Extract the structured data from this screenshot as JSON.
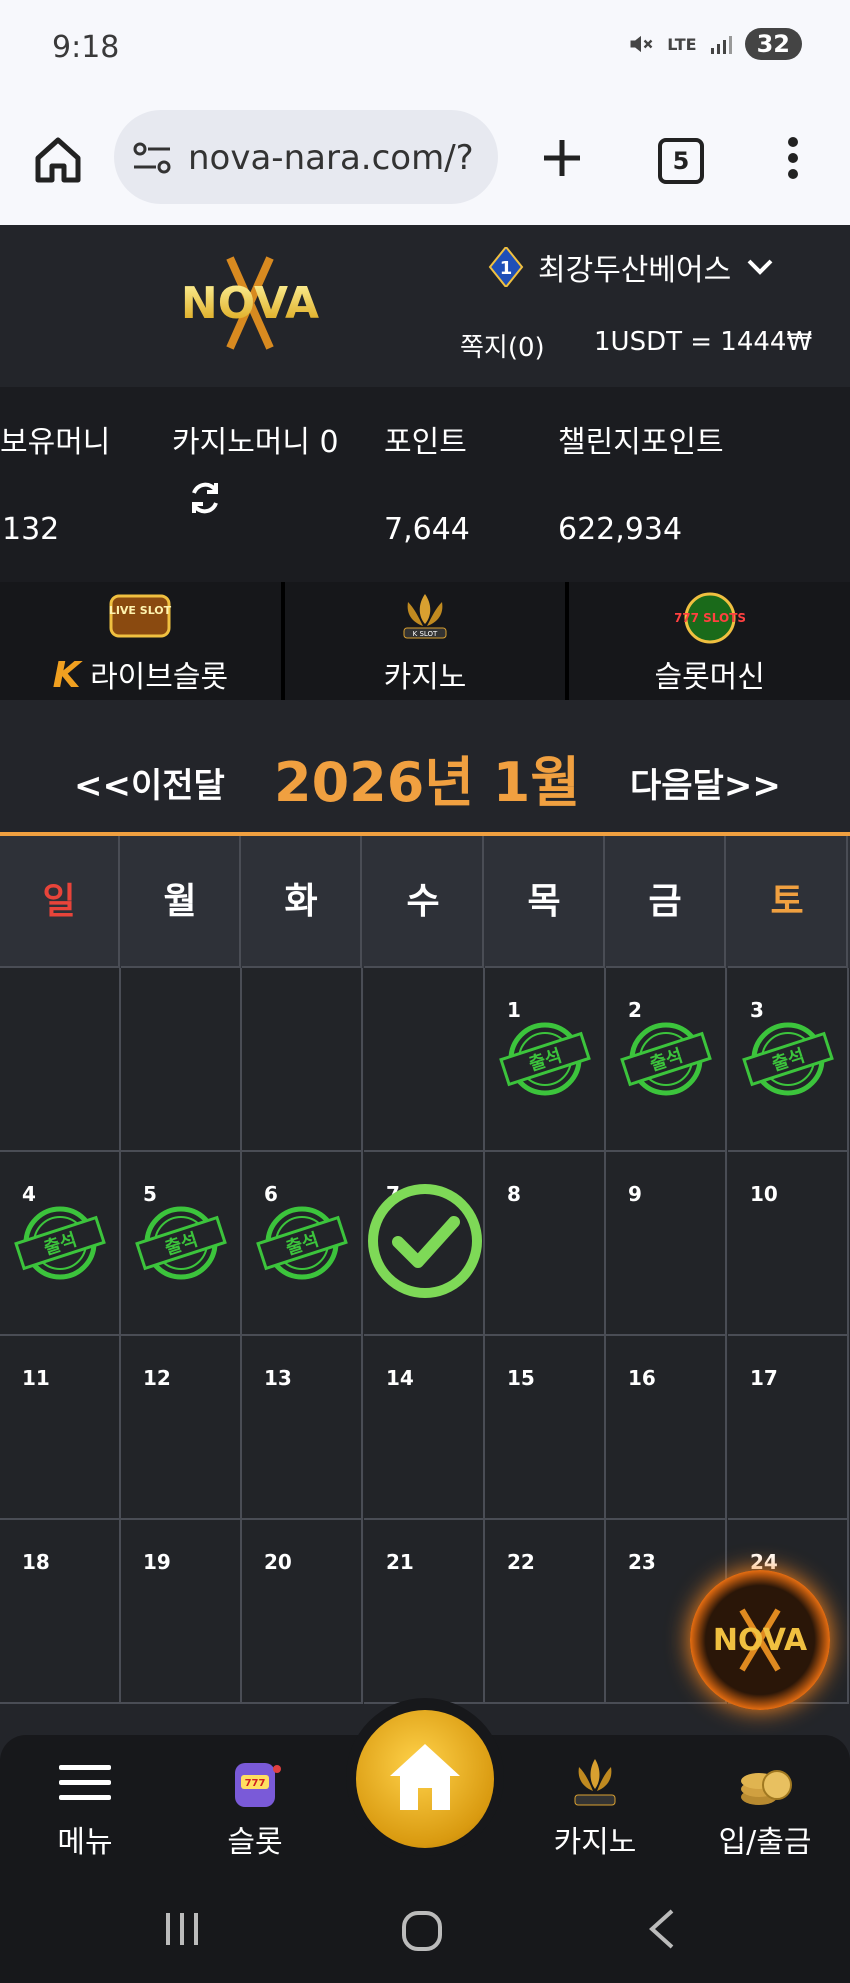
{
  "status_bar": {
    "time": "9:18",
    "network": "LTE",
    "battery": "32"
  },
  "browser": {
    "url": "nova-nara.com/?",
    "tab_count": "5"
  },
  "header": {
    "logo_text": "NOVA",
    "username": "최강두산베어스",
    "level": "1",
    "messages": "쪽지(0)",
    "exchange_rate": "1USDT = 1444₩"
  },
  "balances": {
    "holding_label": "보유머니",
    "holding_value": "132",
    "casino_label": "카지노머니 0",
    "points_label": "포인트",
    "points_value": "7,644",
    "challenge_label": "챌린지포인트",
    "challenge_value": "622,934"
  },
  "game_tabs": {
    "live_slot": {
      "label": "라이브슬롯",
      "icon_text": "LIVE SLOT"
    },
    "casino": {
      "label": "카지노",
      "icon_text": "K SLOT"
    },
    "slot_machine": {
      "label": "슬롯머신",
      "icon_text": "777 SLOTS"
    }
  },
  "calendar": {
    "prev": "<<이전달",
    "month": "2026년 1월",
    "next": "다음달>>",
    "weekdays": [
      "일",
      "월",
      "화",
      "수",
      "목",
      "금",
      "토"
    ],
    "weekday_colors": {
      "sunday": "#e8443a",
      "saturday": "#f0a040",
      "default": "#ffffff"
    },
    "stamp_text": "출석",
    "days": [
      "1",
      "2",
      "3",
      "4",
      "5",
      "6",
      "7",
      "8",
      "9",
      "10",
      "11",
      "12",
      "13",
      "14",
      "15",
      "16",
      "17",
      "18",
      "19",
      "20",
      "21",
      "22",
      "23",
      "24"
    ],
    "attended_days": [
      1,
      2,
      3,
      4,
      5,
      6
    ],
    "today_checked": 7
  },
  "bottom_nav": {
    "menu": "메뉴",
    "slot": "슬롯",
    "casino": "카지노",
    "deposit": "입/출금"
  },
  "colors": {
    "accent": "#f0a040",
    "stamp_green": "#3cc43c",
    "check_green": "#7ed957"
  }
}
